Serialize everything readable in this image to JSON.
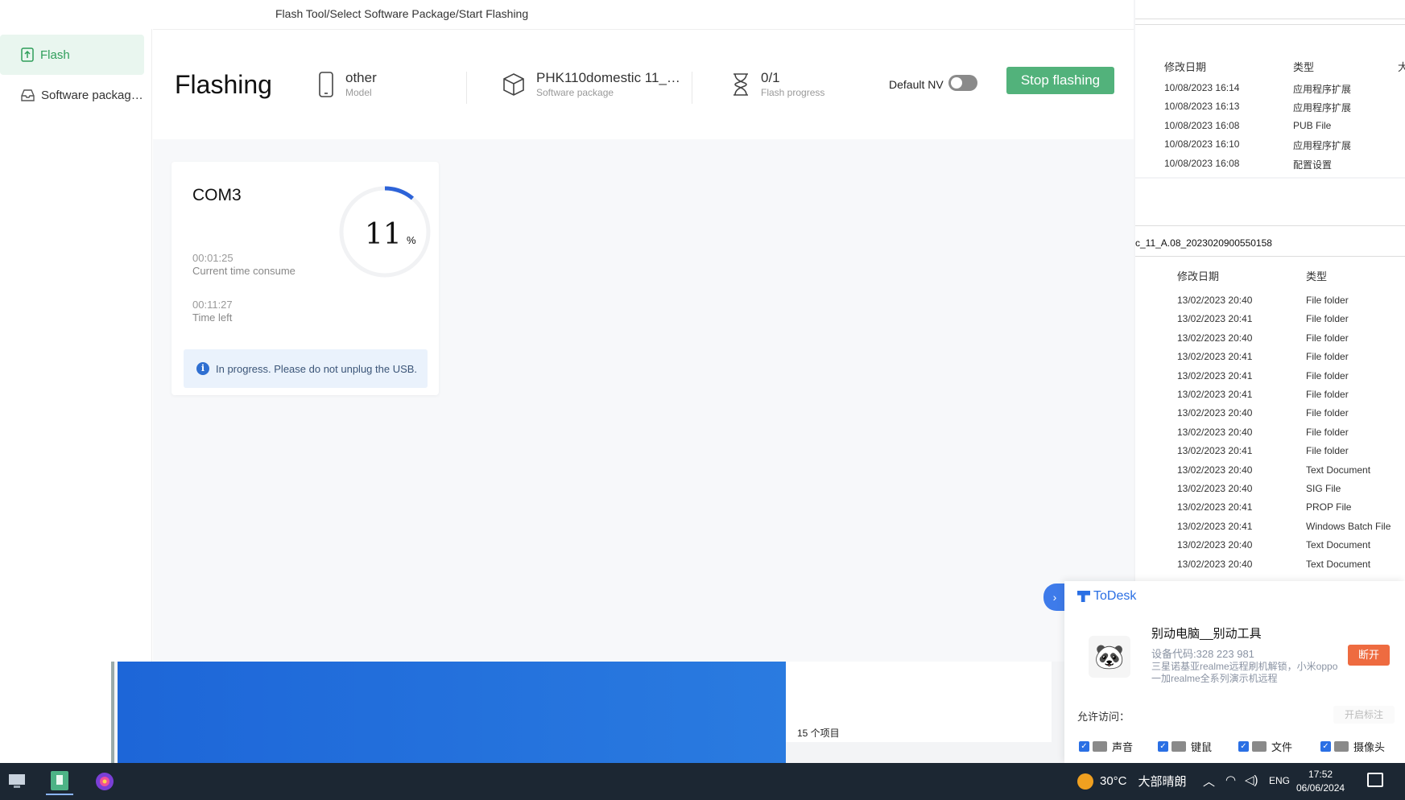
{
  "app": {
    "breadcrumb": "Flash Tool/Select Software Package/Start Flashing",
    "sidebar": [
      {
        "label": "Flash",
        "icon": "flash-upload-icon",
        "active": true
      },
      {
        "label": "Software packag…",
        "icon": "inbox-icon",
        "active": false
      }
    ],
    "header": {
      "title": "Flashing",
      "model_value": "other",
      "model_label": "Model",
      "package_value": "PHK110domestic 11_…",
      "package_label": "Software package",
      "progress_value": "0/1",
      "progress_label": "Flash progress",
      "nv_label": "Default NV",
      "nv_enabled": false,
      "stop_button": "Stop flashing",
      "accent_color": "#52b27b"
    },
    "card": {
      "port": "COM3",
      "percent": "11",
      "percent_sign": "%",
      "progress_fraction": 0.11,
      "elapsed_value": "00:01:25",
      "elapsed_label": "Current time consume",
      "left_value": "00:11:27",
      "left_label": "Time left",
      "notice": "In progress. Please do not unplug the USB."
    }
  },
  "explorer_top": {
    "headers": {
      "date": "修改日期",
      "type": "类型",
      "extra": "大"
    },
    "rows": [
      {
        "date": "10/08/2023 16:14",
        "type": "应用程序扩展"
      },
      {
        "date": "10/08/2023 16:13",
        "type": "应用程序扩展"
      },
      {
        "date": "10/08/2023 16:08",
        "type": "PUB File"
      },
      {
        "date": "10/08/2023 16:10",
        "type": "应用程序扩展"
      },
      {
        "date": "10/08/2023 16:08",
        "type": "配置设置"
      }
    ]
  },
  "explorer_bottom": {
    "path": "c_11_A.08_2023020900550158",
    "headers": {
      "date": "修改日期",
      "type": "类型"
    },
    "rows": [
      {
        "date": "13/02/2023 20:40",
        "type": "File folder"
      },
      {
        "date": "13/02/2023 20:41",
        "type": "File folder"
      },
      {
        "date": "13/02/2023 20:40",
        "type": "File folder"
      },
      {
        "date": "13/02/2023 20:41",
        "type": "File folder"
      },
      {
        "date": "13/02/2023 20:41",
        "type": "File folder"
      },
      {
        "date": "13/02/2023 20:41",
        "type": "File folder"
      },
      {
        "date": "13/02/2023 20:40",
        "type": "File folder"
      },
      {
        "date": "13/02/2023 20:40",
        "type": "File folder"
      },
      {
        "date": "13/02/2023 20:41",
        "type": "File folder"
      },
      {
        "date": "13/02/2023 20:40",
        "type": "Text Document"
      },
      {
        "date": "13/02/2023 20:40",
        "type": "SIG File"
      },
      {
        "date": "13/02/2023 20:41",
        "type": "PROP File"
      },
      {
        "date": "13/02/2023 20:41",
        "type": "Windows Batch File"
      },
      {
        "date": "13/02/2023 20:40",
        "type": "Text Document"
      },
      {
        "date": "13/02/2023 20:40",
        "type": "Text Document"
      }
    ],
    "item_count": "15 个项目"
  },
  "todesk": {
    "brand": "ToDesk",
    "name": "别动电脑__别动工具",
    "device_code": "设备代码:328 223 981",
    "description": "三星诺基亚realme远程刷机解锁，小米oppo一加realme全系列演示机远程",
    "disconnect": "断开",
    "allow_access": "允许访问：",
    "mark_button": "开启标注",
    "permissions": [
      {
        "label": "声音",
        "icon": "speaker-icon"
      },
      {
        "label": "键鼠",
        "icon": "keyboard-icon"
      },
      {
        "label": "文件",
        "icon": "folder-icon"
      },
      {
        "label": "摄像头",
        "icon": "camera-icon"
      }
    ]
  },
  "taskbar": {
    "temperature": "30°C",
    "weather": "大部晴朗",
    "language": "ENG",
    "time": "17:52",
    "date": "06/06/2024"
  }
}
